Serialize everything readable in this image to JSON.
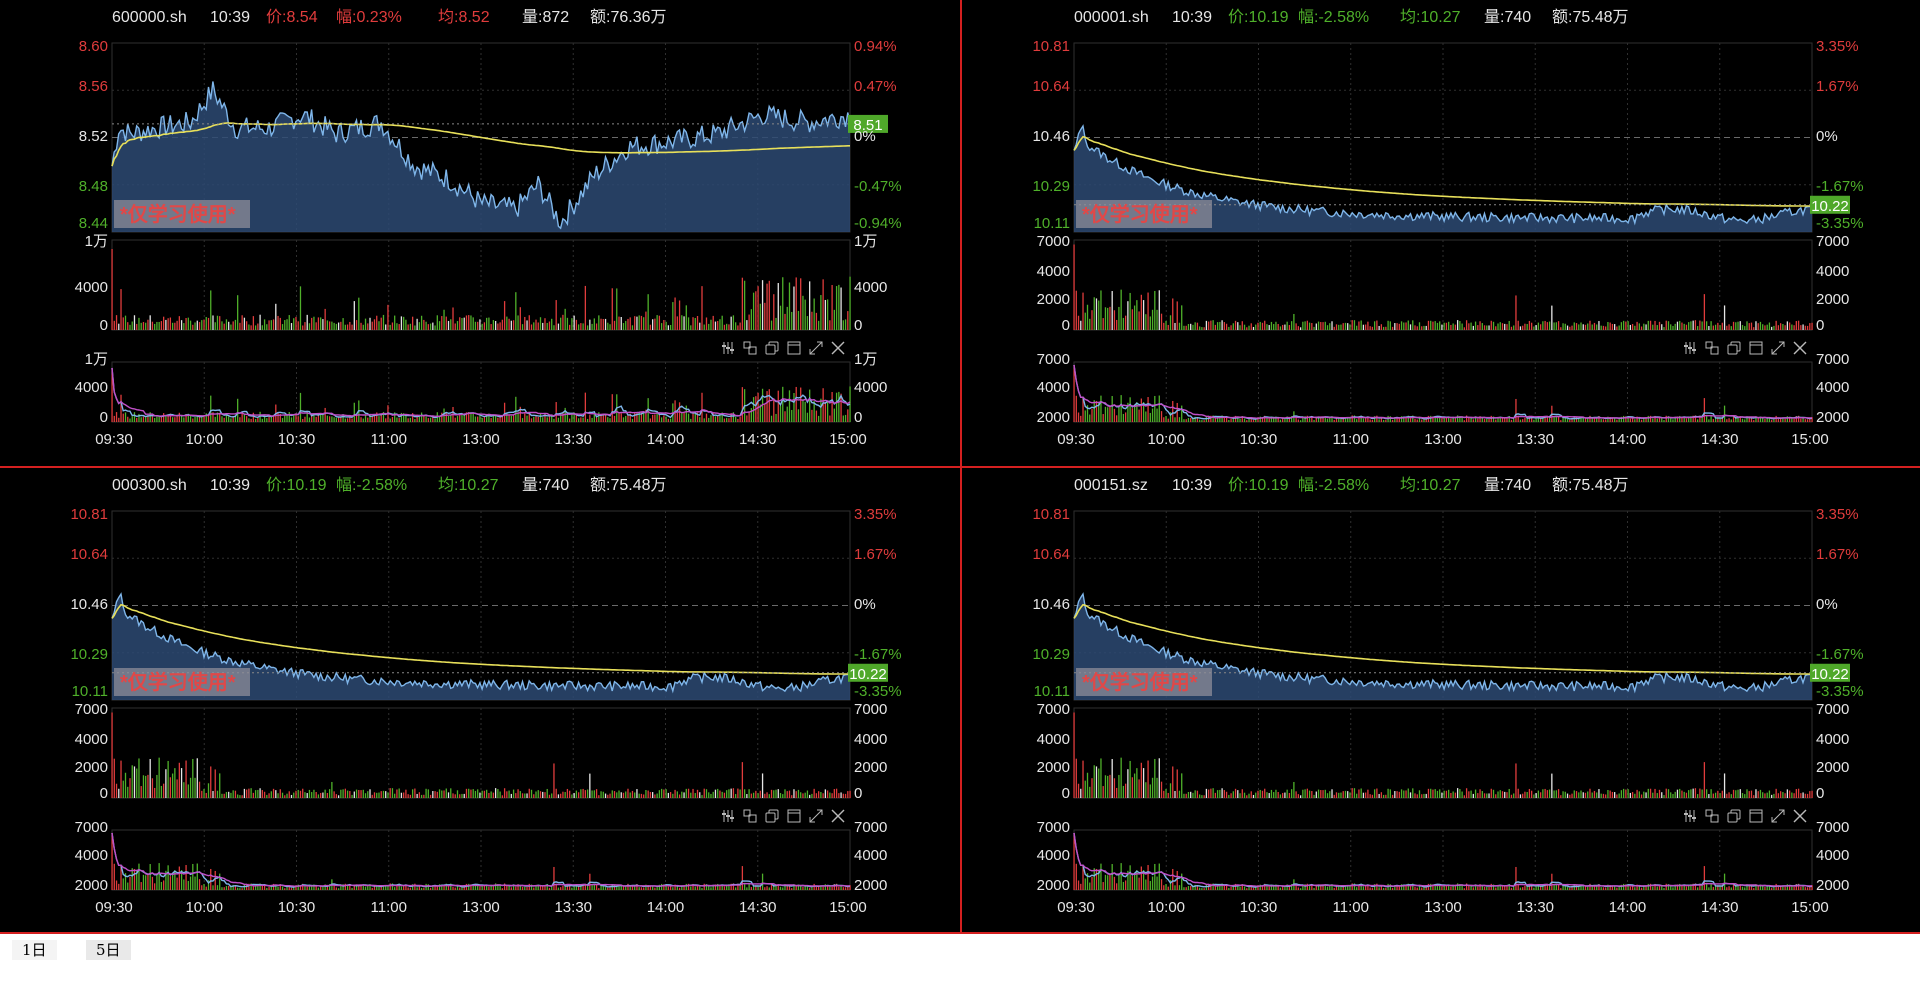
{
  "colors": {
    "bg": "#000000",
    "grid": "#2f2f2f",
    "divider": "#d42020",
    "price_line": "#7fb6ea",
    "avg_line": "#e8e05a",
    "area_fill": "#2d4a73",
    "up": "#e03c3c",
    "down": "#4fb02a",
    "neutral": "#e6e6e6",
    "tag_bg": "#4fa82a",
    "watermark": "#e04848",
    "toolbar_icon": "#b9b9b9",
    "vol_ma1": "#7fb6ea",
    "vol_ma2": "#c050c8"
  },
  "watermark": "*仅学习使用*",
  "toolbar_icons": [
    "settings-sliders-icon",
    "layout-icon",
    "copy-icon",
    "window-icon",
    "expand-icon",
    "close-icon"
  ],
  "tabs": [
    {
      "label": "1日"
    },
    {
      "label": "5日"
    }
  ],
  "charts": [
    {
      "code": "600000.sh",
      "time": "10:39",
      "price_label": "价:8.54",
      "change_label": "幅:0.23%",
      "avg_label": "均:8.52",
      "volume_label": "量:872",
      "amount_label": "额:76.36万",
      "header_color": "up",
      "price_ticks": [
        "8.60",
        "8.56",
        "8.52",
        "8.48",
        "8.44"
      ],
      "price_tick_colors": [
        "up",
        "up",
        "neutral",
        "down",
        "down"
      ],
      "pct_ticks": [
        "0.94%",
        "0.47%",
        "0%",
        "-0.47%",
        "-0.94%"
      ],
      "price_tag": "8.51",
      "time_ticks": [
        "09:30",
        "10:00",
        "10:30",
        "11:00",
        "13:00",
        "13:30",
        "14:00",
        "14:30",
        "15:00"
      ],
      "vol_ticks_left": [
        "1万",
        "4000",
        "0"
      ],
      "vol_ticks_right": [
        "1万",
        "4000",
        "0"
      ],
      "vol2_ticks_left": [
        "1万",
        "4000",
        "0"
      ],
      "vol2_ticks_right": [
        "1万",
        "4000",
        "0"
      ],
      "chart_data": {
        "type": "line",
        "title": "600000.sh",
        "ylim": [
          8.44,
          8.6
        ],
        "ref_price": 8.52,
        "vol_max": 10000,
        "trend": "mid",
        "seed": 7
      }
    },
    {
      "code": "000001.sh",
      "time": "10:39",
      "price_label": "价:10.19",
      "change_label": "幅:-2.58%",
      "avg_label": "均:10.27",
      "volume_label": "量:740",
      "amount_label": "额:75.48万",
      "header_color": "down",
      "price_ticks": [
        "10.81",
        "10.64",
        "10.46",
        "10.29",
        "10.11"
      ],
      "price_tick_colors": [
        "up",
        "up",
        "neutral",
        "down",
        "down"
      ],
      "pct_ticks": [
        "3.35%",
        "1.67%",
        "0%",
        "-1.67%",
        "-3.35%"
      ],
      "price_tag": "10.22",
      "time_ticks": [
        "09:30",
        "10:00",
        "10:30",
        "11:00",
        "13:00",
        "13:30",
        "14:00",
        "14:30",
        "15:00"
      ],
      "vol_ticks_left": [
        "7000",
        "4000",
        "2000",
        "0"
      ],
      "vol_ticks_right": [
        "7000",
        "4000",
        "2000",
        "0"
      ],
      "vol2_ticks_left": [
        "7000",
        "4000",
        "2000"
      ],
      "vol2_ticks_right": [
        "7000",
        "4000",
        "2000"
      ],
      "chart_data": {
        "type": "line",
        "title": "000001.sh",
        "ylim": [
          10.11,
          10.81
        ],
        "ref_price": 10.46,
        "vol_max": 7000,
        "trend": "down",
        "seed": 13
      }
    },
    {
      "code": "000300.sh",
      "time": "10:39",
      "price_label": "价:10.19",
      "change_label": "幅:-2.58%",
      "avg_label": "均:10.27",
      "volume_label": "量:740",
      "amount_label": "额:75.48万",
      "header_color": "down",
      "price_ticks": [
        "10.81",
        "10.64",
        "10.46",
        "10.29",
        "10.11"
      ],
      "price_tick_colors": [
        "up",
        "up",
        "neutral",
        "down",
        "down"
      ],
      "pct_ticks": [
        "3.35%",
        "1.67%",
        "0%",
        "-1.67%",
        "-3.35%"
      ],
      "price_tag": "10.22",
      "time_ticks": [
        "09:30",
        "10:00",
        "10:30",
        "11:00",
        "13:00",
        "13:30",
        "14:00",
        "14:30",
        "15:00"
      ],
      "vol_ticks_left": [
        "7000",
        "4000",
        "2000",
        "0"
      ],
      "vol_ticks_right": [
        "7000",
        "4000",
        "2000",
        "0"
      ],
      "vol2_ticks_left": [
        "7000",
        "4000",
        "2000"
      ],
      "vol2_ticks_right": [
        "7000",
        "4000",
        "2000"
      ],
      "chart_data": {
        "type": "line",
        "title": "000300.sh",
        "ylim": [
          10.11,
          10.81
        ],
        "ref_price": 10.46,
        "vol_max": 7000,
        "trend": "down",
        "seed": 13
      }
    },
    {
      "code": "000151.sz",
      "time": "10:39",
      "price_label": "价:10.19",
      "change_label": "幅:-2.58%",
      "avg_label": "均:10.27",
      "volume_label": "量:740",
      "amount_label": "额:75.48万",
      "header_color": "down",
      "price_ticks": [
        "10.81",
        "10.64",
        "10.46",
        "10.29",
        "10.11"
      ],
      "price_tick_colors": [
        "up",
        "up",
        "neutral",
        "down",
        "down"
      ],
      "pct_ticks": [
        "3.35%",
        "1.67%",
        "0%",
        "-1.67%",
        "-3.35%"
      ],
      "price_tag": "10.22",
      "time_ticks": [
        "09:30",
        "10:00",
        "10:30",
        "11:00",
        "13:00",
        "13:30",
        "14:00",
        "14:30",
        "15:00"
      ],
      "vol_ticks_left": [
        "7000",
        "4000",
        "2000",
        "0"
      ],
      "vol_ticks_right": [
        "7000",
        "4000",
        "2000",
        "0"
      ],
      "vol2_ticks_left": [
        "7000",
        "4000",
        "2000"
      ],
      "vol2_ticks_right": [
        "7000",
        "4000",
        "2000"
      ],
      "chart_data": {
        "type": "line",
        "title": "000151.sz",
        "ylim": [
          10.11,
          10.81
        ],
        "ref_price": 10.46,
        "vol_max": 7000,
        "trend": "down",
        "seed": 13
      }
    }
  ]
}
